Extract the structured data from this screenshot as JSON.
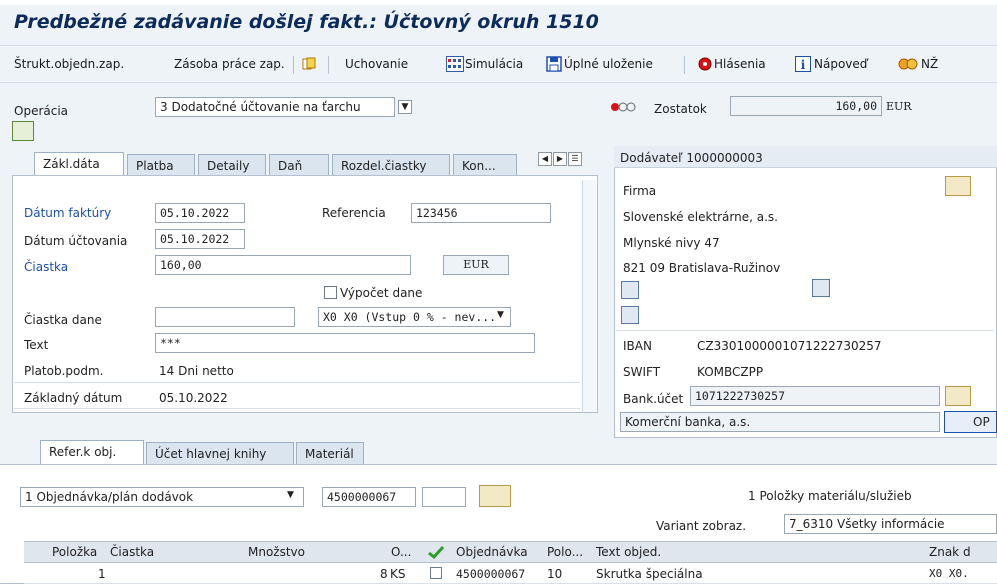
{
  "title": "Predbežné zadávanie došlej fakt.: Účtovný okruh 1510",
  "toolbar": {
    "struct": "Štrukt.objedn.zap.",
    "stock": "Zásoba práce zap.",
    "hold": "Uchovanie",
    "simulate": "Simulácia",
    "save": "Úplné uloženie",
    "messages": "Hlásenia",
    "help": "Nápoveď",
    "nz": "NŽ"
  },
  "header": {
    "operation_label": "Operácia",
    "operation_value": "3 Dodatočné účtovanie na ťarchu",
    "balance_label": "Zostatok",
    "balance_value": "160,00",
    "balance_currency": "EUR"
  },
  "tabs": [
    "Zákl.dáta",
    "Platba",
    "Detaily",
    "Daň",
    "Rozdel.čiastky",
    "Kon..."
  ],
  "basic": {
    "invoice_date_label": "Dátum faktúry",
    "invoice_date": "05.10.2022",
    "reference_label": "Referencia",
    "reference": "123456",
    "posting_date_label": "Dátum účtovania",
    "posting_date": "05.10.2022",
    "amount_label": "Čiastka",
    "amount": "160,00",
    "currency": "EUR",
    "calc_tax_label": "Výpočet dane",
    "tax_amount_label": "Čiastka dane",
    "tax_amount": "",
    "tax_code": "X0 X0 (Vstup 0 % - nev...",
    "text_label": "Text",
    "text": "***",
    "payment_terms_label": "Platob.podm.",
    "payment_terms": "14 Dni netto",
    "baseline_label": "Základný dátum",
    "baseline": "05.10.2022"
  },
  "vendor": {
    "header": "Dodávateľ 1000000003",
    "company_label": "Firma",
    "name": "Slovenské elektrárne, a.s.",
    "street": "Mlynské nivy 47",
    "city": "821 09 Bratislava-Ružinov",
    "iban_label": "IBAN",
    "iban": "CZ3301000001071222730257",
    "swift_label": "SWIFT",
    "swift": "KOMBCZPP",
    "bank_account_label": "Bank.účet",
    "bank_account": "1071222730257",
    "bank_name": "Komerční banka, a.s.",
    "op": "OP"
  },
  "lower_tabs": [
    "Refer.k obj.",
    "Účet hlavnej knihy",
    "Materiál"
  ],
  "po": {
    "doc_type": "1 Objednávka/plán dodávok",
    "po_number": "4500000067",
    "items_type": "1 Položky materiálu/služieb",
    "variant_label": "Variant zobraz.",
    "variant_value": "7_6310 Všetky informácie"
  },
  "table": {
    "headers": [
      "Položka",
      "Čiastka",
      "Množstvo",
      "O...",
      "",
      "Objednávka",
      "Polo...",
      "Text objed.",
      "Znak d"
    ],
    "row": {
      "item": "1",
      "amount": "",
      "qty": "8",
      "unit": "KS",
      "po": "4500000067",
      "pos": "10",
      "text": "Skrutka špeciálna",
      "tax": "X0  X0."
    }
  },
  "colors": {
    "accent": "#0c2b5a",
    "label_blue": "#1d4fae",
    "bg": "#eef3f8"
  }
}
